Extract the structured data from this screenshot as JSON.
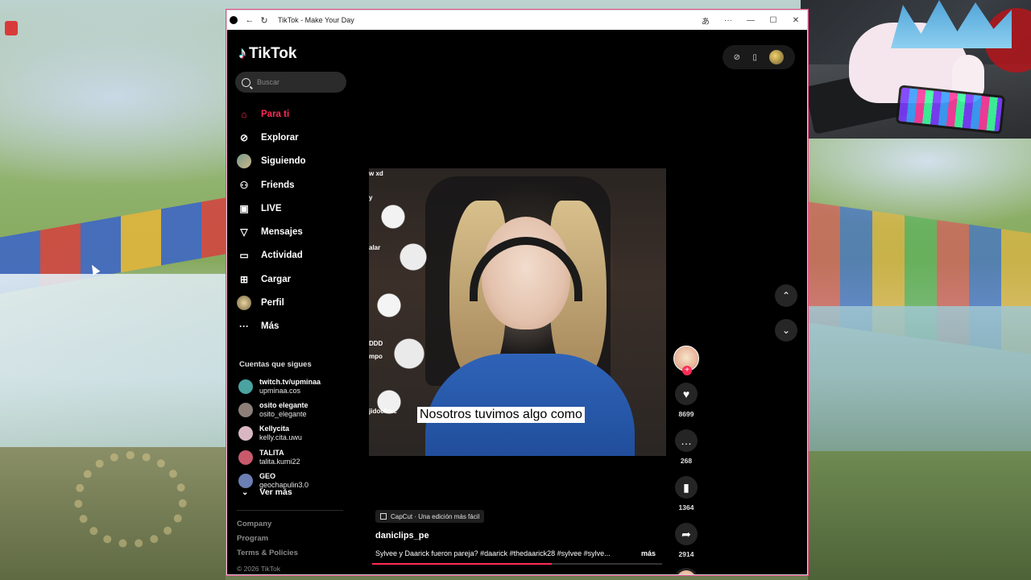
{
  "window": {
    "title": "TikTok - Make Your Day",
    "controls": {
      "translate": "あ",
      "more": "···",
      "minimize": "—",
      "maximize": "☐",
      "close": "✕"
    }
  },
  "brand": {
    "name": "TikTok",
    "accent": "#fe2c55"
  },
  "search": {
    "placeholder": "Buscar"
  },
  "nav": [
    {
      "label": "Para ti",
      "icon": "home-icon",
      "active": true
    },
    {
      "label": "Explorar",
      "icon": "compass-icon"
    },
    {
      "label": "Siguiendo",
      "icon": "following-avatar"
    },
    {
      "label": "Friends",
      "icon": "friends-icon"
    },
    {
      "label": "LIVE",
      "icon": "live-icon"
    },
    {
      "label": "Mensajes",
      "icon": "send-icon"
    },
    {
      "label": "Actividad",
      "icon": "inbox-icon"
    },
    {
      "label": "Cargar",
      "icon": "upload-icon"
    },
    {
      "label": "Perfil",
      "icon": "profile-avatar"
    },
    {
      "label": "Más",
      "icon": "more-icon"
    }
  ],
  "following": {
    "title": "Cuentas que sigues",
    "accounts": [
      {
        "name": "twitch.tv/upminaa",
        "user": "upminaa.cos",
        "color": "#4aa3a1"
      },
      {
        "name": "osito elegante",
        "user": "osito_elegante",
        "color": "#8d7f78"
      },
      {
        "name": "Kellycita",
        "user": "kelly.cita.uwu",
        "color": "#d8b7c2"
      },
      {
        "name": "TALITA",
        "user": "talita.kumi22",
        "color": "#c85a6c"
      },
      {
        "name": "GEO",
        "user": "geochapulin3.0",
        "color": "#6b7fb5"
      }
    ],
    "see_more": "Ver más"
  },
  "footer": {
    "links": [
      "Company",
      "Program",
      "Terms & Policies"
    ],
    "copyright": "© 2026 TikTok"
  },
  "video": {
    "caption": "Nosotros tuvimos algo como",
    "side_text": [
      "w xd",
      "y",
      "alar",
      "DDD",
      "mpo",
      "jidocfvxc"
    ],
    "progress": 0.62
  },
  "actions": {
    "likes": "8699",
    "comments": "268",
    "saves": "1364",
    "shares": "2914"
  },
  "post": {
    "capcut": "CapCut · Una edición más fácil",
    "username": "daniclips_pe",
    "description": "Sylvee y Daarick fueron pareja? #daarick #thedaarick28 #sylvee #sylve...",
    "more": "más"
  }
}
